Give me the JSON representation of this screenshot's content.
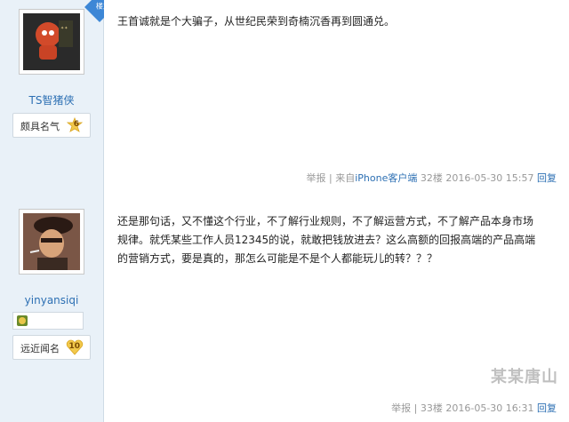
{
  "posts": [
    {
      "username": "TS智猪侠",
      "badge_label": "颇具名气",
      "badge_level": "6",
      "corner_tag": "楼主",
      "text": "王首诚就是个大骗子，从世纪民荣到奇楠沉香再到圆通兑。",
      "meta": {
        "report": "举报",
        "divider": "|",
        "source_prefix": "来自",
        "source_link": "iPhone客户端",
        "floor": "32楼",
        "time": "2016-05-30 15:57",
        "reply": "回复"
      },
      "colors": {
        "badge": "#f2c94c"
      }
    },
    {
      "username": "yinyansiqi",
      "badge_label": "远近闻名",
      "badge_level": "10",
      "text": "还是那句话，又不懂这个行业，不了解行业规则，不了解运营方式，不了解产品本身市场规律。就凭某些工作人员12345的说，就敢把钱放进去？这么高额的回报高端的产品高端的营销方式，要是真的，那怎么可能是不是个人都能玩儿的转？？？",
      "meta": {
        "report": "举报",
        "divider": "|",
        "floor": "33楼",
        "time": "2016-05-30 16:31",
        "reply": "回复"
      },
      "colors": {
        "badge": "#f2c94c"
      }
    }
  ],
  "watermark": "某某唐山"
}
